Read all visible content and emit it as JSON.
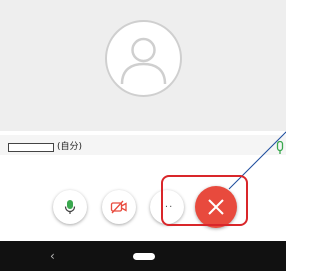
{
  "participant": {
    "self_label": "(自分)",
    "avatar_icon": "person-silhouette-icon"
  },
  "controls": {
    "mic_icon": "microphone-icon",
    "camera_icon": "camera-off-icon",
    "more_icon": "more-icon",
    "more_glyph": "···",
    "hangup_icon": "close-icon"
  },
  "nav": {
    "back_glyph": "‹",
    "back_icon": "back-icon",
    "home_icon": "home-pill-icon"
  },
  "colors": {
    "hangup": "#e84a3d",
    "highlight": "#d9262a",
    "mic_active": "#3aa84f",
    "leader_line": "#1f4e9e"
  }
}
